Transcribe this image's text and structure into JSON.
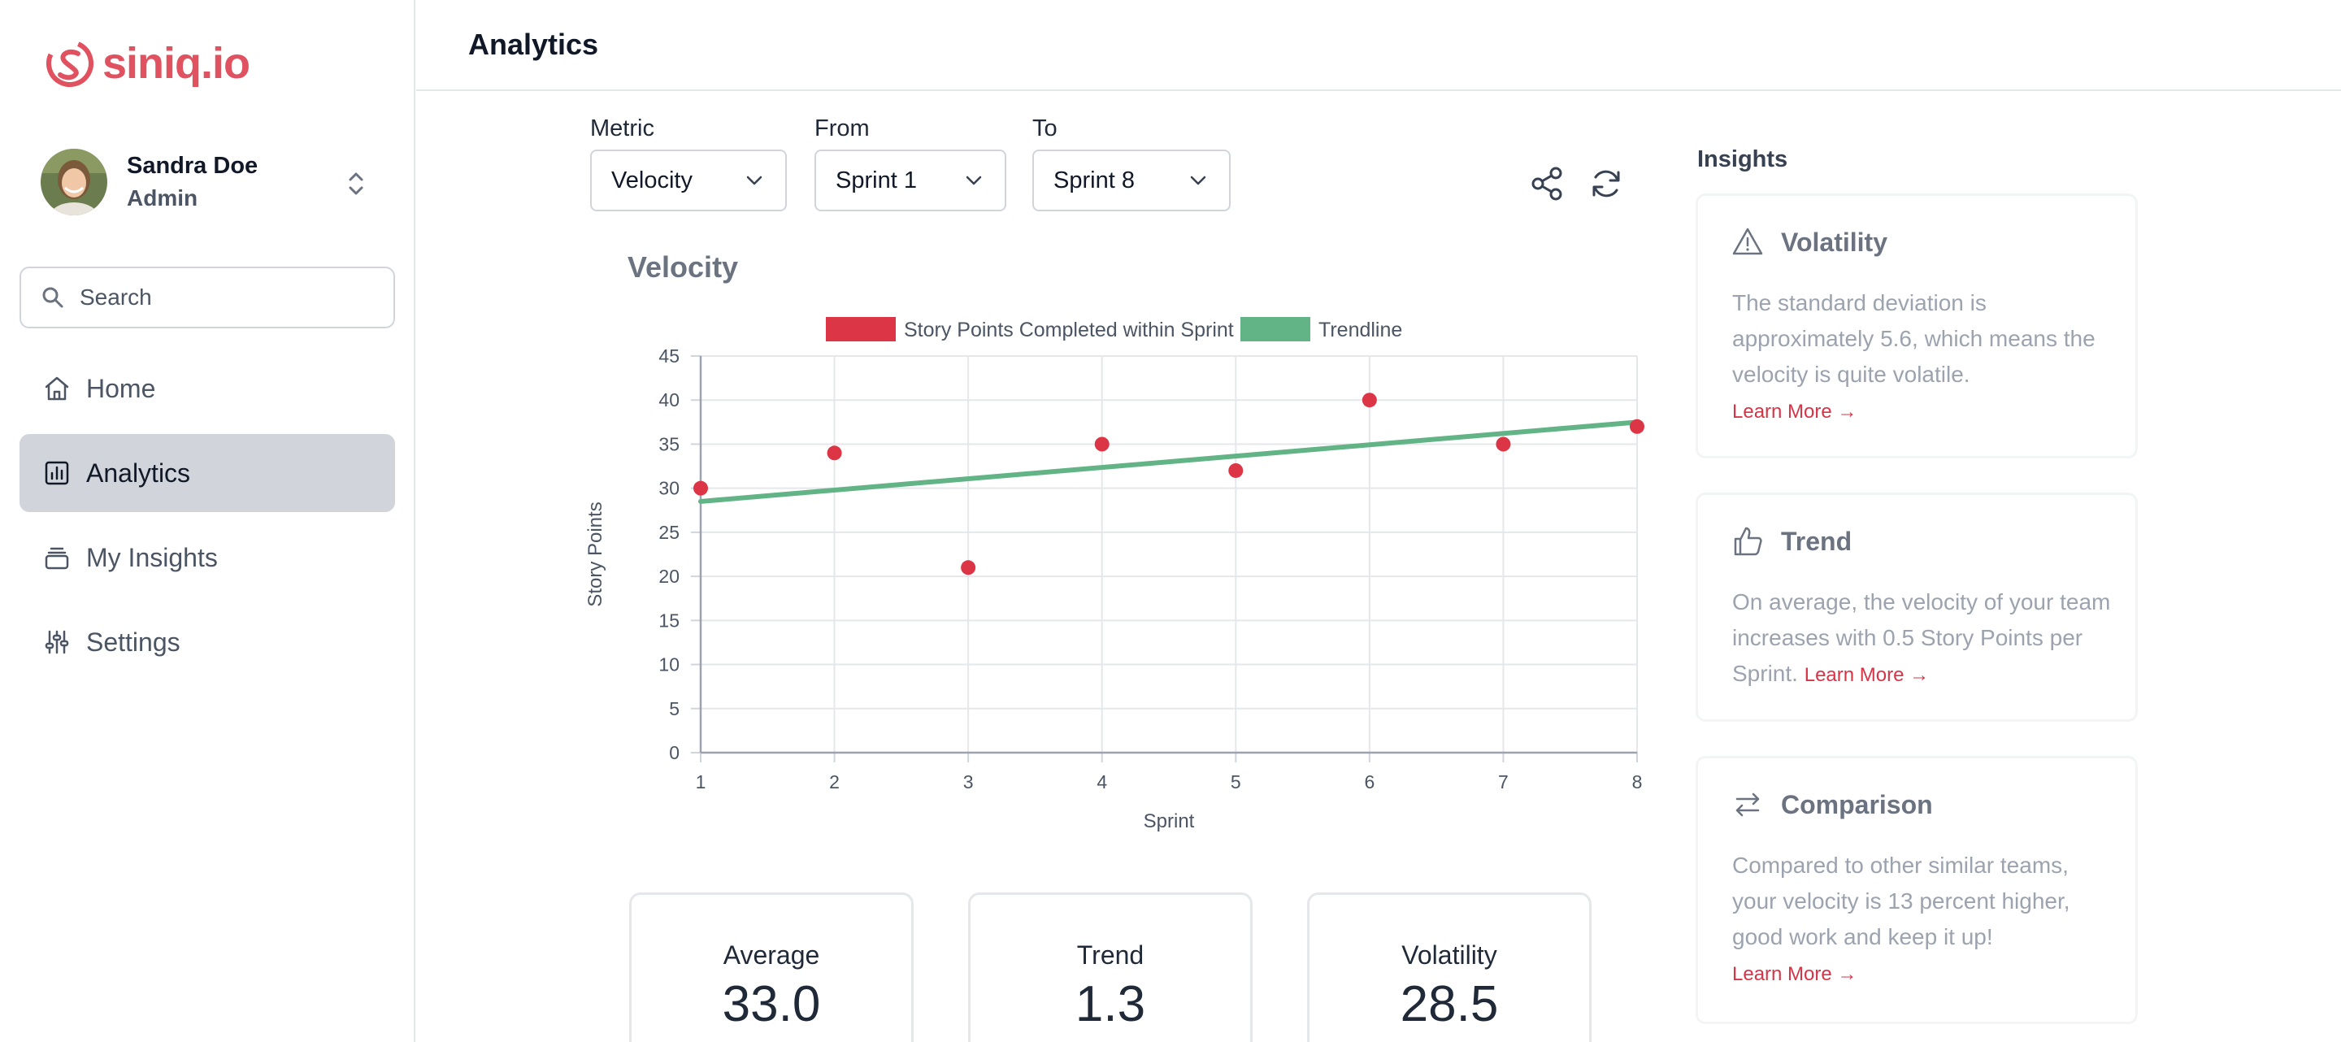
{
  "app": {
    "logo_text": "siniq.io",
    "brand_color": "#e0525f"
  },
  "user": {
    "name": "Sandra Doe",
    "role": "Admin"
  },
  "search": {
    "placeholder": "Search"
  },
  "sidebar": {
    "items": [
      {
        "label": "Home",
        "icon": "home-icon",
        "active": false
      },
      {
        "label": "Analytics",
        "icon": "chart-icon",
        "active": true
      },
      {
        "label": "My Insights",
        "icon": "stack-icon",
        "active": false
      },
      {
        "label": "Settings",
        "icon": "sliders-icon",
        "active": false
      }
    ]
  },
  "header": {
    "title": "Analytics"
  },
  "filters": {
    "metric": {
      "label": "Metric",
      "value": "Velocity"
    },
    "from": {
      "label": "From",
      "value": "Sprint 1"
    },
    "to": {
      "label": "To",
      "value": "Sprint 8"
    }
  },
  "chart": {
    "title": "Velocity"
  },
  "chart_data": {
    "type": "scatter",
    "title": "",
    "xlabel": "Sprint",
    "ylabel": "Story Points",
    "xlim": [
      1,
      8
    ],
    "ylim": [
      0,
      45
    ],
    "x_ticks": [
      1,
      2,
      3,
      4,
      5,
      6,
      7,
      8
    ],
    "y_ticks": [
      0,
      5,
      10,
      15,
      20,
      25,
      30,
      35,
      40,
      45
    ],
    "grid": true,
    "legend_position": "top",
    "series": [
      {
        "name": "Story Points Completed within Sprint",
        "type": "scatter",
        "color": "#dc3545",
        "x": [
          1,
          2,
          3,
          4,
          5,
          6,
          7,
          8
        ],
        "y": [
          30,
          34,
          21,
          35,
          32,
          40,
          35,
          37
        ]
      },
      {
        "name": "Trendline",
        "type": "line",
        "color": "#62b385",
        "x": [
          1,
          8
        ],
        "y": [
          28.5,
          37.5
        ]
      }
    ]
  },
  "stats": [
    {
      "label": "Average",
      "value": "33.0"
    },
    {
      "label": "Trend",
      "value": "1.3"
    },
    {
      "label": "Volatility",
      "value": "28.5"
    }
  ],
  "insights": {
    "title": "Insights",
    "learn_more": "Learn More →",
    "cards": [
      {
        "title": "Volatility",
        "icon": "warning-icon",
        "body": "The standard deviation is approximately 5.6, which means the velocity is quite volatile."
      },
      {
        "title": "Trend",
        "icon": "thumbs-up-icon",
        "body": "On average, the velocity of your team increases with 0.5 Story Points per Sprint."
      },
      {
        "title": "Comparison",
        "icon": "arrows-swap-icon",
        "body": "Compared to other similar teams, your velocity is 13 percent higher, good work and keep it up!"
      }
    ]
  }
}
